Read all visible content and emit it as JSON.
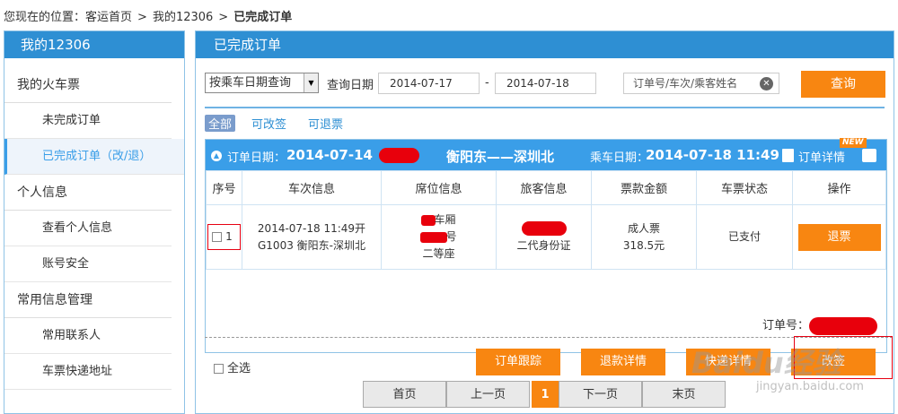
{
  "breadcrumb": {
    "prefix": "您现在的位置：",
    "home": "客运首页",
    "parent": "我的12306",
    "current": "已完成订单",
    "sep": ">"
  },
  "sidebar": {
    "title": "我的12306",
    "groups": [
      {
        "title": "我的火车票",
        "items": [
          "未完成订单",
          "已完成订单（改/退）"
        ]
      },
      {
        "title": "个人信息",
        "items": [
          "查看个人信息",
          "账号安全"
        ]
      },
      {
        "title": "常用信息管理",
        "items": [
          "常用联系人",
          "车票快递地址"
        ]
      }
    ],
    "active_item": "已完成订单（改/退）"
  },
  "main": {
    "title": "已完成订单",
    "search": {
      "mode_select": "按乘车日期查询",
      "date_label": "查询日期",
      "date_from": "2014-07-17",
      "date_to": "2014-07-18",
      "dash": "-",
      "keyword_placeholder": "订单号/车次/乘客姓名",
      "query_button": "查询"
    },
    "filters": [
      "全部",
      "可改签",
      "可退票"
    ],
    "order": {
      "order_date_label": "订单日期：",
      "order_date": "2014-07-14",
      "route": "衡阳东——深圳北",
      "ride_date_label": "乘车日期：",
      "ride_date": "2014-07-18 11:49",
      "detail_label": "订单详情",
      "new_badge": "NEW",
      "columns": [
        "序号",
        "车次信息",
        "席位信息",
        "旅客信息",
        "票款金额",
        "车票状态",
        "操作"
      ],
      "row": {
        "seq": "1",
        "train_time": "2014-07-18 11:49开",
        "train_info": "G1003 衡阳东-深圳北",
        "seat_car": "车厢",
        "seat_no": "号",
        "seat_class": "二等座",
        "passenger_id": "二代身份证",
        "ticket_type": "成人票",
        "price": "318.5元",
        "status": "已支付",
        "action": "退票"
      },
      "order_no_label": "订单号："
    },
    "select_all": "全选",
    "actions": [
      "订单跟踪",
      "退款详情",
      "快递详情",
      "改签"
    ]
  },
  "pager": [
    "首页",
    "上一页",
    "1",
    "下一页",
    "末页"
  ],
  "watermark": {
    "text": "Baidu经验",
    "url": "jingyan.baidu.com"
  },
  "colors": {
    "brand_blue": "#2e8fd3",
    "accent_orange": "#f88611",
    "redaction": "#e8000c"
  }
}
